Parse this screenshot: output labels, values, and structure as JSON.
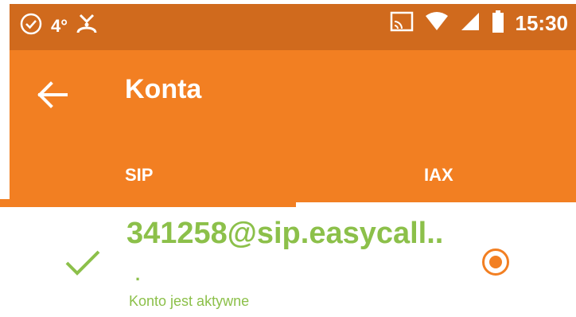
{
  "status_bar": {
    "temperature": "4°",
    "time": "15:30",
    "icons": [
      "check-circle-icon",
      "weather-icon",
      "cast-icon",
      "wifi-icon",
      "signal-icon",
      "battery-icon"
    ]
  },
  "app_bar": {
    "title": "Konta",
    "back_icon": "arrow-left-icon"
  },
  "tabs": [
    {
      "label": "SIP",
      "selected": true
    },
    {
      "label": "IAX",
      "selected": false
    }
  ],
  "account": {
    "name": "341258@sip.easycall..",
    "separator": ".",
    "status": "Konto jest aktywne",
    "active": true,
    "selected": true
  },
  "colors": {
    "status_bar": "#d06a1d",
    "primary": "#f27f22",
    "accent_green": "#8cc04a"
  }
}
